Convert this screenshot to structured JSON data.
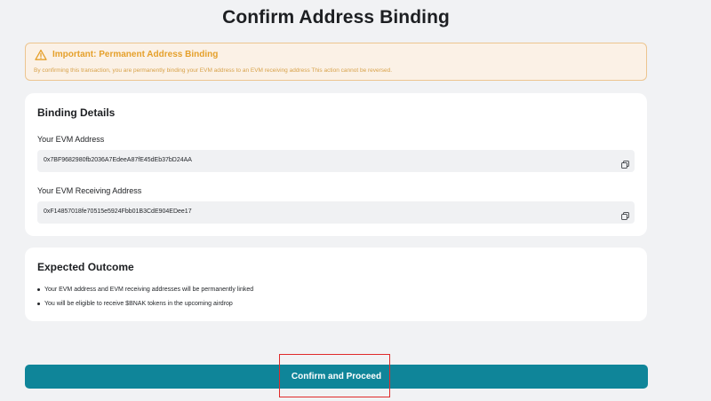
{
  "page": {
    "title": "Confirm Address Binding"
  },
  "warning": {
    "title": "Important: Permanent Address Binding",
    "text": "By confirming this transaction, you are permanently binding your EVM address to an EVM receiving address This action cannot be reversed.",
    "icon": "warning-triangle-icon",
    "accent_color": "#e5a02b",
    "background_color": "#fbf1e6",
    "border_color": "#ecc590"
  },
  "binding_details": {
    "heading": "Binding Details",
    "evm_address": {
      "label": "Your EVM Address",
      "value": "0x7BF9682980fb2036A7EdeeA87fE45dEb37bD24AA",
      "copy_icon": "copy-icon"
    },
    "receiving_address": {
      "label": "Your EVM Receiving Address",
      "value": "0xF14857018fe70515e5924Fbb01B3CdE904EDee17",
      "copy_icon": "copy-icon"
    }
  },
  "expected_outcome": {
    "heading": "Expected Outcome",
    "items": [
      "Your EVM address and EVM receiving addresses will be permanently linked",
      "You will be eligible to receive $BNAK tokens in the upcoming airdrop"
    ]
  },
  "actions": {
    "confirm_label": "Confirm and Proceed",
    "button_color": "#0f8599",
    "highlight_color": "#e02a2a"
  }
}
